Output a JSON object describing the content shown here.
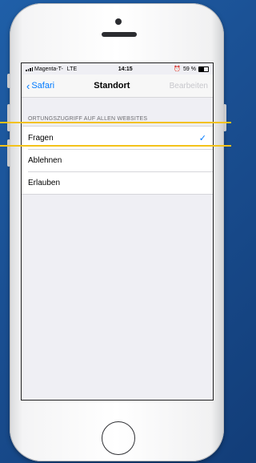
{
  "status_bar": {
    "carrier": "Magenta-T-",
    "network": "LTE",
    "time": "14:15",
    "battery": "59 %"
  },
  "nav": {
    "back_label": "Safari",
    "title": "Standort",
    "edit_label": "Bearbeiten"
  },
  "section": {
    "header": "ORTUNGSZUGRIFF AUF ALLEN WEBSITES",
    "options": [
      {
        "label": "Fragen",
        "selected": true
      },
      {
        "label": "Ablehnen",
        "selected": false
      },
      {
        "label": "Erlauben",
        "selected": false
      }
    ],
    "checkmark": "✓"
  },
  "colors": {
    "accent": "#007aff",
    "highlight": "#f3c21a",
    "background": "#1a4f92"
  }
}
